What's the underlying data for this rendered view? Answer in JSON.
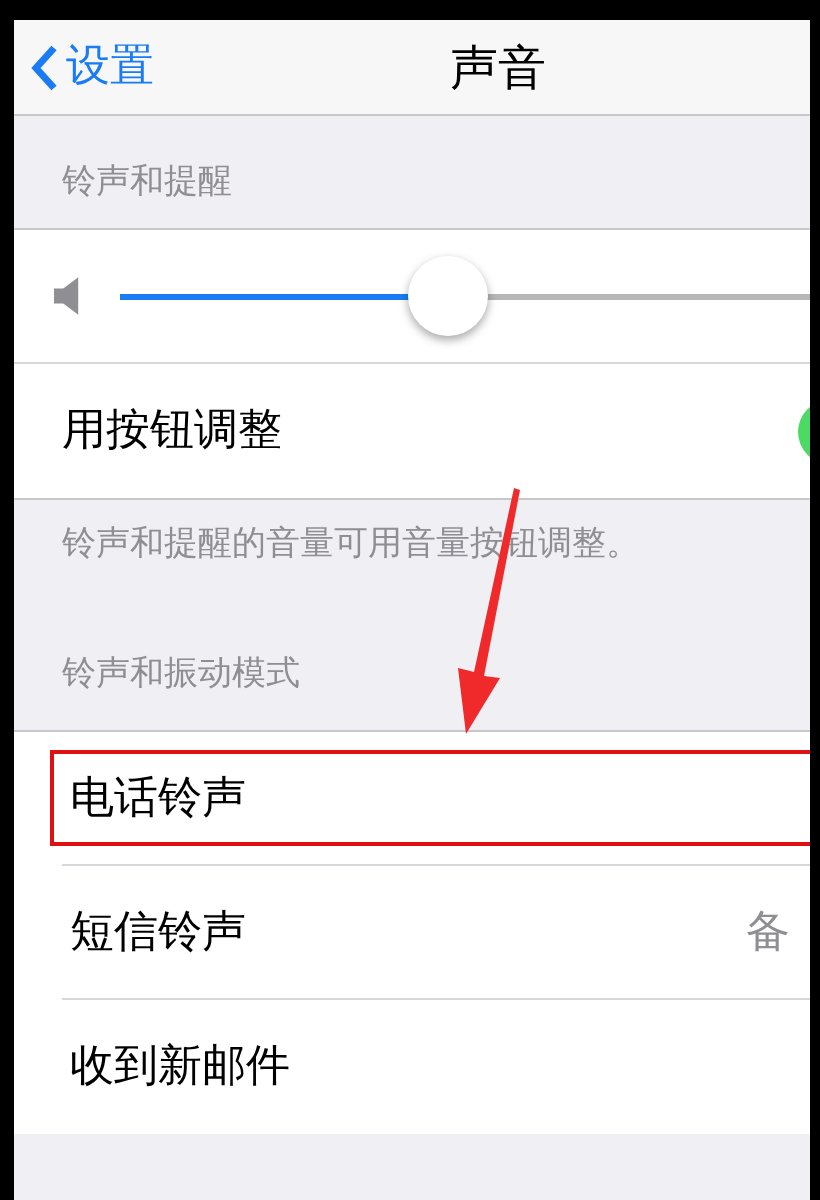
{
  "nav": {
    "back": "设置",
    "title": "声音"
  },
  "section_1": {
    "header": "铃声和提醒",
    "slider": {
      "level": 0.42
    },
    "toggle": {
      "label": "用按钮调整",
      "on": true
    },
    "footer": "铃声和提醒的音量可用音量按钮调整。"
  },
  "section_2": {
    "header": "铃声和振动模式",
    "rows": [
      {
        "label": "电话铃声",
        "highlighted": true
      },
      {
        "label": "短信铃声",
        "value": "备",
        "highlighted": false
      },
      {
        "label": "收到新邮件",
        "highlighted": false
      }
    ]
  }
}
